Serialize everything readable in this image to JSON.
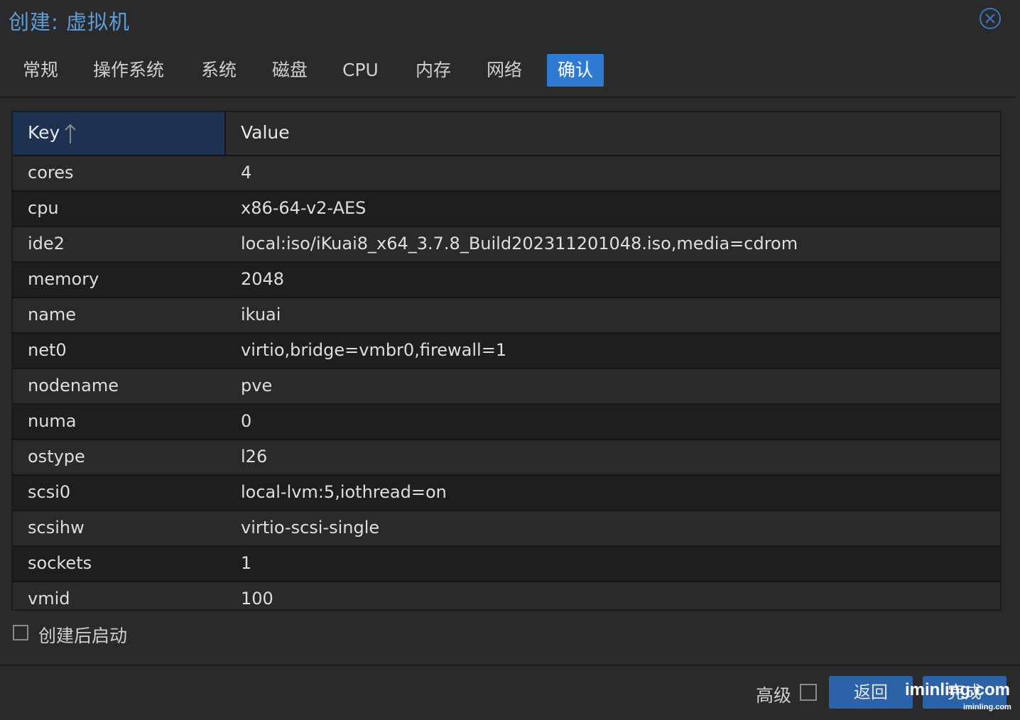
{
  "dialog": {
    "title": "创建: 虚拟机",
    "close_icon": "close-circle-icon"
  },
  "tabs": [
    {
      "label": "常规",
      "active": false
    },
    {
      "label": "操作系统",
      "active": false
    },
    {
      "label": "系统",
      "active": false
    },
    {
      "label": "磁盘",
      "active": false
    },
    {
      "label": "CPU",
      "active": false
    },
    {
      "label": "内存",
      "active": false
    },
    {
      "label": "网络",
      "active": false
    },
    {
      "label": "确认",
      "active": true
    }
  ],
  "grid": {
    "key_header": "Key",
    "value_header": "Value",
    "sort_icon": "sort-ascending-icon",
    "rows": [
      {
        "key": "cores",
        "value": "4"
      },
      {
        "key": "cpu",
        "value": "x86-64-v2-AES"
      },
      {
        "key": "ide2",
        "value": "local:iso/iKuai8_x64_3.7.8_Build202311201048.iso,media=cdrom"
      },
      {
        "key": "memory",
        "value": "2048"
      },
      {
        "key": "name",
        "value": "ikuai"
      },
      {
        "key": "net0",
        "value": "virtio,bridge=vmbr0,firewall=1"
      },
      {
        "key": "nodename",
        "value": "pve"
      },
      {
        "key": "numa",
        "value": "0"
      },
      {
        "key": "ostype",
        "value": "l26"
      },
      {
        "key": "scsi0",
        "value": "local-lvm:5,iothread=on"
      },
      {
        "key": "scsihw",
        "value": "virtio-scsi-single"
      },
      {
        "key": "sockets",
        "value": "1"
      },
      {
        "key": "vmid",
        "value": "100"
      }
    ]
  },
  "start_after_create": {
    "label": "创建后启动",
    "checked": false
  },
  "footer": {
    "advanced_label": "高级",
    "advanced_checked": false,
    "back_label": "返回",
    "finish_label": "完成",
    "watermark": "iminling.com",
    "watermark_small": "iminling.com"
  },
  "colors": {
    "accent": "#2f7bd3",
    "title": "#5d9ed6",
    "button": "#2b62a8",
    "background": "#2a2a2d"
  }
}
